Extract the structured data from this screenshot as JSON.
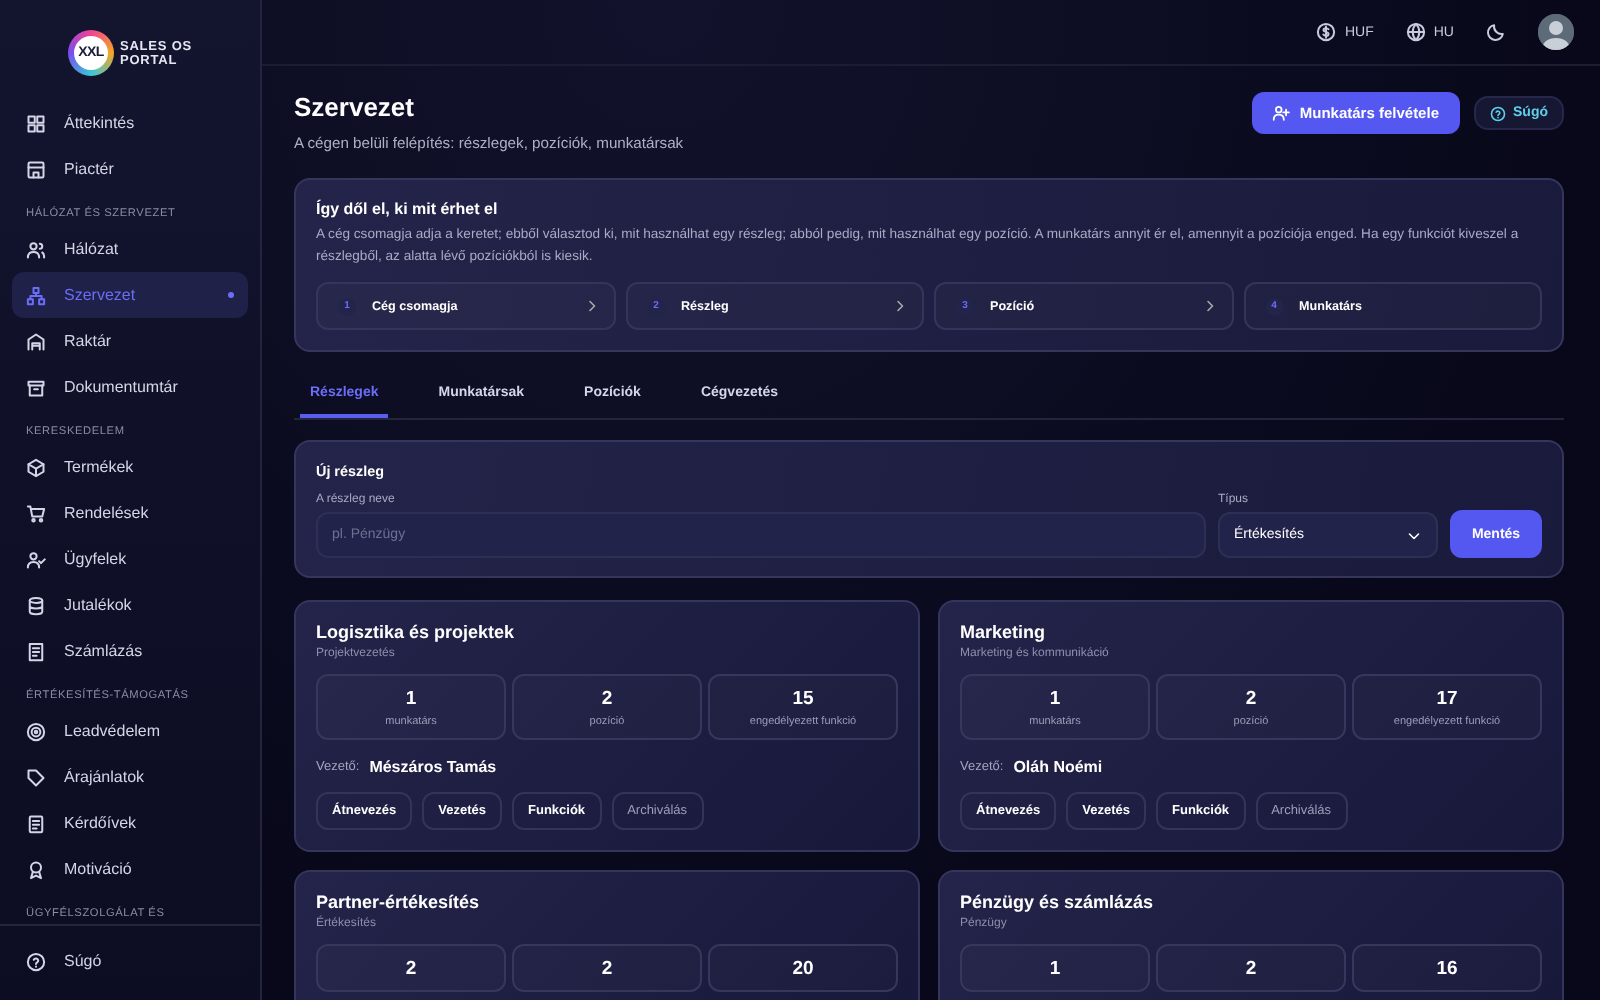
{
  "logo": {
    "badge": "XXL",
    "line_1": "SALES OS",
    "line_2": "PORTAL"
  },
  "sidebar": {
    "sections": [
      {
        "items": [
          {
            "label": "Áttekintés",
            "selected": false
          },
          {
            "label": "Piactér",
            "selected": false
          }
        ]
      },
      {
        "heading": "HÁLÓZAT ÉS SZERVEZET",
        "items": [
          {
            "label": "Hálózat",
            "selected": false
          },
          {
            "label": "Szervezet",
            "selected": true
          },
          {
            "label": "Raktár",
            "selected": false
          },
          {
            "label": "Dokumentumtár",
            "selected": false
          }
        ]
      },
      {
        "heading": "KERESKEDELEM",
        "items": [
          {
            "label": "Termékek",
            "selected": false
          },
          {
            "label": "Rendelések",
            "selected": false
          },
          {
            "label": "Ügyfelek",
            "selected": false
          },
          {
            "label": "Jutalékok",
            "selected": false
          },
          {
            "label": "Számlázás",
            "selected": false
          }
        ]
      },
      {
        "heading": "ÉRTÉKESÍTÉS-TÁMOGATÁS",
        "items": [
          {
            "label": "Leadvédelem",
            "selected": false
          },
          {
            "label": "Árajánlatok",
            "selected": false
          },
          {
            "label": "Kérdőívek",
            "selected": false
          },
          {
            "label": "Motiváció",
            "selected": false
          }
        ]
      },
      {
        "heading": "ÜGYFÉLSZOLGÁLAT ÉS"
      }
    ],
    "footer": {
      "label": "Súgó"
    }
  },
  "topbar": {
    "currency": "HUF",
    "language": "HU"
  },
  "header": {
    "title": "Szervezet",
    "subtitle": "A cégen belüli felépítés: részlegek, pozíciók, munkatársak",
    "primary_button": "Munkatárs felvétele",
    "help_button": "Súgó"
  },
  "info": {
    "title": "Így dől el, ki mit érhet el",
    "text": "A cég csomagja adja a keretet; ebből választod ki, mit használhat egy részleg; abból pedig, mit használhat egy pozíció. A munkatárs annyit ér el, amennyit a pozíciója enged. Ha egy funkciót kiveszel a részlegből, az alatta lévő pozíciókból is kiesik.",
    "steps": [
      {
        "number": "1",
        "label": "Cég csomagja"
      },
      {
        "number": "2",
        "label": "Részleg"
      },
      {
        "number": "3",
        "label": "Pozíció"
      },
      {
        "number": "4",
        "label": "Munkatárs"
      }
    ]
  },
  "tabs": [
    {
      "label": "Részlegek",
      "selected": true
    },
    {
      "label": "Munkatársak",
      "selected": false
    },
    {
      "label": "Pozíciók",
      "selected": false
    },
    {
      "label": "Cégvezetés",
      "selected": false
    }
  ],
  "form": {
    "title": "Új részleg",
    "name_label": "A részleg neve",
    "name_placeholder": "pl. Pénzügy",
    "type_label": "Típus",
    "type_value": "Értékesítés",
    "save_button": "Mentés"
  },
  "departments": [
    {
      "name": "Logisztika és projektek",
      "category": "Projektvezetés",
      "stats": [
        {
          "value": "1",
          "label": "munkatárs"
        },
        {
          "value": "2",
          "label": "pozíció"
        },
        {
          "value": "15",
          "label": "engedélyezett funkció"
        }
      ],
      "leader_label": "Vezető:",
      "leader": "Mészáros Tamás",
      "actions": [
        {
          "label": "Átnevezés",
          "kind": "normal"
        },
        {
          "label": "Vezetés",
          "kind": "normal"
        },
        {
          "label": "Funkciók",
          "kind": "normal"
        },
        {
          "label": "Archiválás",
          "kind": "muted"
        }
      ]
    },
    {
      "name": "Marketing",
      "category": "Marketing és kommunikáció",
      "stats": [
        {
          "value": "1",
          "label": "munkatárs"
        },
        {
          "value": "2",
          "label": "pozíció"
        },
        {
          "value": "17",
          "label": "engedélyezett funkció"
        }
      ],
      "leader_label": "Vezető:",
      "leader": "Oláh Noémi",
      "actions": [
        {
          "label": "Átnevezés",
          "kind": "normal"
        },
        {
          "label": "Vezetés",
          "kind": "normal"
        },
        {
          "label": "Funkciók",
          "kind": "normal"
        },
        {
          "label": "Archiválás",
          "kind": "muted"
        }
      ]
    },
    {
      "name": "Partner-értékesítés",
      "category": "Értékesítés",
      "stats": [
        {
          "value": "2"
        },
        {
          "value": "2"
        },
        {
          "value": "20"
        }
      ]
    },
    {
      "name": "Pénzügy és számlázás",
      "category": "Pénzügy",
      "stats": [
        {
          "value": "1"
        },
        {
          "value": "2"
        },
        {
          "value": "16"
        }
      ]
    }
  ]
}
